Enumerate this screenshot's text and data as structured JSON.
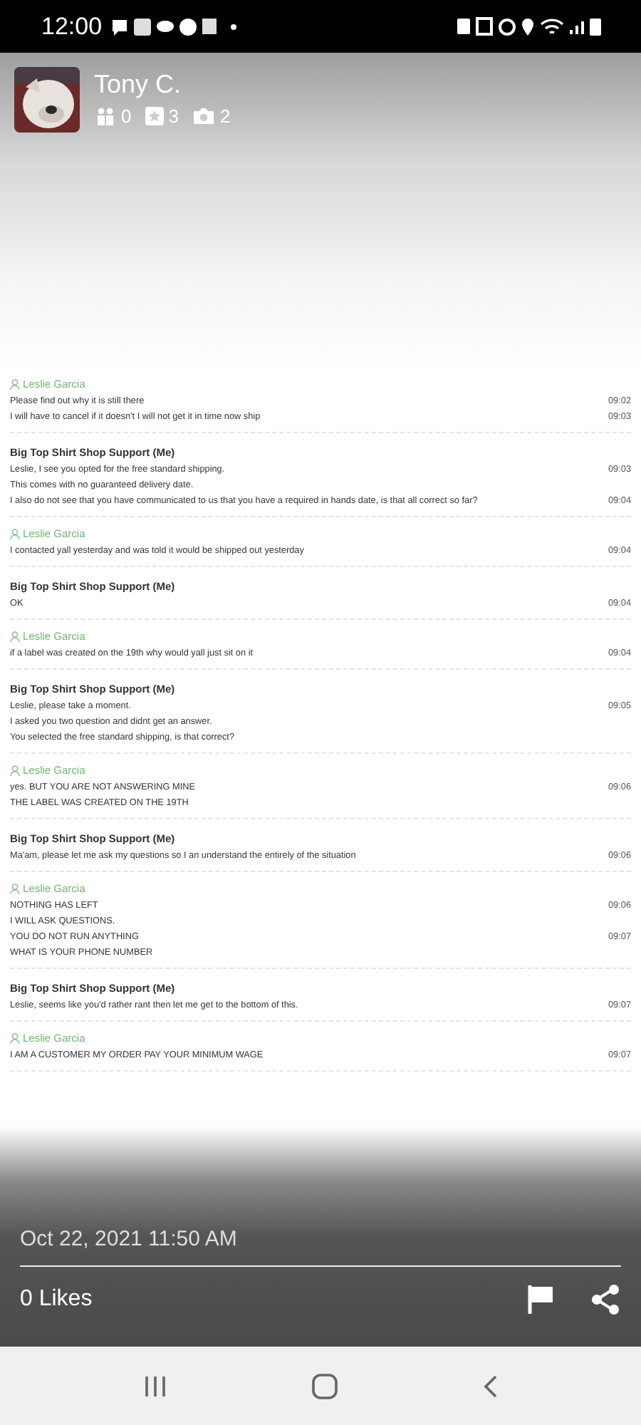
{
  "status_bar": {
    "time": "12:00"
  },
  "profile": {
    "name": "Tony C.",
    "stats": [
      {
        "kind": "friends",
        "count": "0"
      },
      {
        "kind": "reviews",
        "count": "3"
      },
      {
        "kind": "photos",
        "count": "2"
      }
    ]
  },
  "messages": [
    {
      "kind": "customer",
      "sender": "Leslie Garcia",
      "lines": [
        {
          "text": "Please find out why it is still there",
          "time": "09:02"
        },
        {
          "text": "I will have to cancel if it doesn't I will not get it in time now ship",
          "time": "09:03"
        }
      ]
    },
    {
      "kind": "agent",
      "sender": "Big Top Shirt Shop Support (Me)",
      "lines": [
        {
          "text": "Leslie, I see you opted for the free standard shipping.",
          "time": "09:03"
        },
        {
          "text": "This comes with no guaranteed delivery date."
        },
        {
          "text": "I also do not see that you have communicated to us that you have a required in hands date, is that all correct so far?",
          "time": "09:04"
        }
      ]
    },
    {
      "kind": "customer",
      "sender": "Leslie Garcia",
      "lines": [
        {
          "text": "I contacted yall yesterday and was told it would be shipped out yesterday",
          "time": "09:04"
        }
      ]
    },
    {
      "kind": "agent",
      "sender": "Big Top Shirt Shop Support (Me)",
      "lines": [
        {
          "text": "OK",
          "time": "09:04"
        }
      ]
    },
    {
      "kind": "customer",
      "sender": "Leslie Garcia",
      "lines": [
        {
          "text": "if a label was created on the 19th why would yall just sit on it",
          "time": "09:04"
        }
      ]
    },
    {
      "kind": "agent",
      "sender": "Big Top Shirt Shop Support (Me)",
      "lines": [
        {
          "text": "Leslie, please take a moment.",
          "time": "09:05"
        },
        {
          "text": "I asked you two question and didnt get an answer."
        },
        {
          "text": "You selected the free standard shipping, is that correct?"
        }
      ]
    },
    {
      "kind": "customer",
      "sender": "Leslie Garcia",
      "lines": [
        {
          "text": "yes. BUT YOU ARE NOT ANSWERING MINE",
          "time": "09:06"
        },
        {
          "text": "THE LABEL WAS CREATED ON THE 19TH"
        }
      ]
    },
    {
      "kind": "agent",
      "sender": "Big Top Shirt Shop Support (Me)",
      "lines": [
        {
          "text": "Ma'am, please let me ask my questions so I an understand the entirely of the situation",
          "time": "09:06"
        }
      ]
    },
    {
      "kind": "customer",
      "sender": "Leslie Garcia",
      "lines": [
        {
          "text": "NOTHING HAS LEFT",
          "time": "09:06"
        },
        {
          "text": "I WILL ASK QUESTIONS."
        },
        {
          "text": "YOU DO NOT RUN ANYTHING",
          "time": "09:07"
        },
        {
          "text": "WHAT IS YOUR PHONE NUMBER"
        }
      ]
    },
    {
      "kind": "agent",
      "sender": "Big Top Shirt Shop Support (Me)",
      "lines": [
        {
          "text": "Leslie, seems like you'd rather rant then let me get to the bottom of this.",
          "time": "09:07"
        }
      ]
    },
    {
      "kind": "customer",
      "sender": "Leslie Garcia",
      "lines": [
        {
          "text": "I AM A CUSTOMER MY ORDER PAY YOUR MINIMUM WAGE",
          "time": "09:07"
        }
      ]
    }
  ],
  "footer": {
    "date": "Oct 22, 2021 11:50 AM",
    "likes": "0 Likes"
  }
}
